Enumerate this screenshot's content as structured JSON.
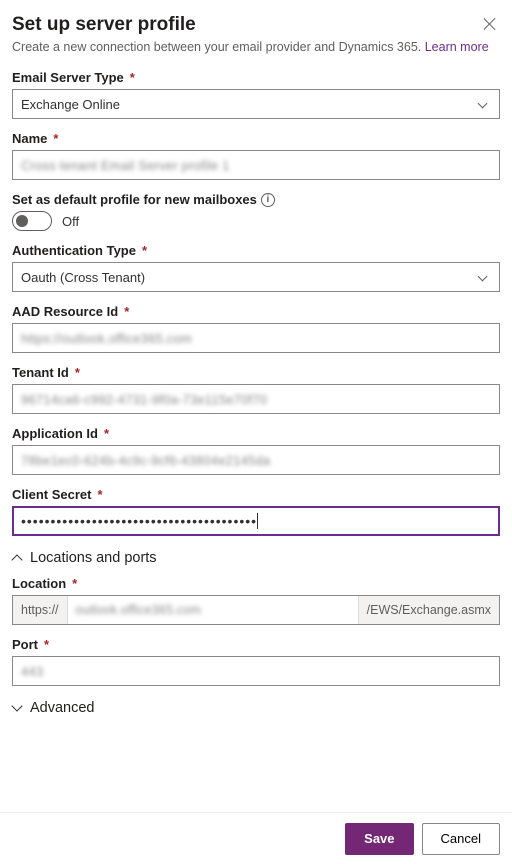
{
  "header": {
    "title": "Set up server profile",
    "description": "Create a new connection between your email provider and Dynamics 365. ",
    "learn_more": "Learn more"
  },
  "fields": {
    "email_server_type": {
      "label": "Email Server Type",
      "value": "Exchange Online"
    },
    "name": {
      "label": "Name",
      "value": "Cross tenant Email Server profile 1"
    },
    "default_profile": {
      "label": "Set as default profile for new mailboxes",
      "state": "Off"
    },
    "auth_type": {
      "label": "Authentication Type",
      "value": "Oauth (Cross Tenant)"
    },
    "aad_resource_id": {
      "label": "AAD Resource Id",
      "value": "https://outlook.office365.com"
    },
    "tenant_id": {
      "label": "Tenant Id",
      "value": "96714ca6-c992-4731-9f0a-73e115e70f70"
    },
    "application_id": {
      "label": "Application Id",
      "value": "78be1ec0-624b-4c9c-9cf6-43804e2145da"
    },
    "client_secret": {
      "label": "Client Secret",
      "value": "••••••••••••••••••••••••••••••••••••••••"
    }
  },
  "sections": {
    "locations": {
      "title": "Locations and ports",
      "expanded": true
    },
    "advanced": {
      "title": "Advanced",
      "expanded": false
    }
  },
  "location": {
    "label": "Location",
    "prefix": "https://",
    "value": "outlook.office365.com",
    "suffix": "/EWS/Exchange.asmx"
  },
  "port": {
    "label": "Port",
    "value": "443"
  },
  "footer": {
    "save": "Save",
    "cancel": "Cancel"
  }
}
